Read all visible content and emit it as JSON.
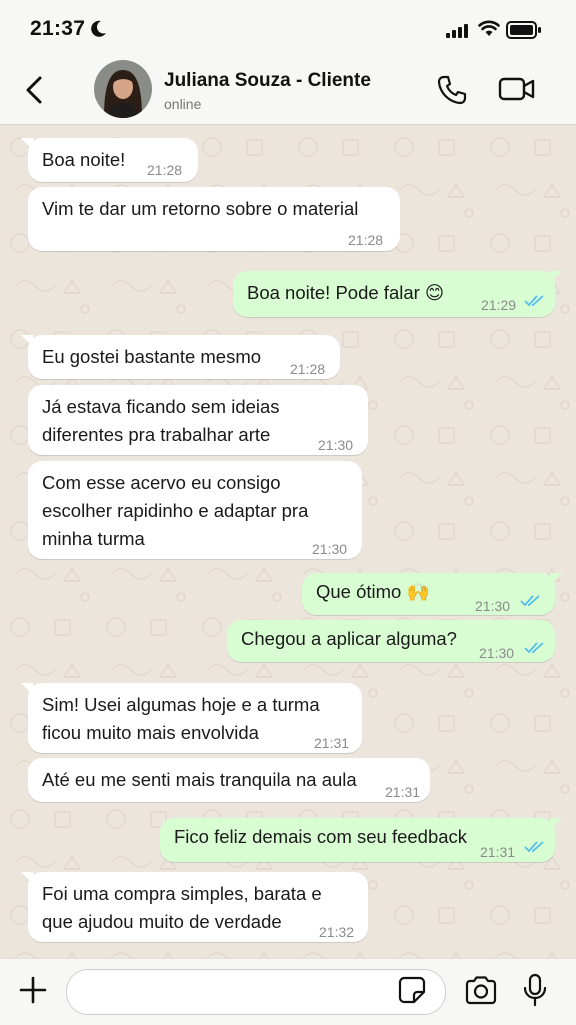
{
  "status_bar": {
    "time": "21:37"
  },
  "contact": {
    "name": "Juliana Souza - Cliente",
    "status": "online"
  },
  "messages": [
    {
      "dir": "in",
      "text": "Boa noite!",
      "time": "21:28"
    },
    {
      "dir": "in",
      "text": "Vim te dar um retorno sobre o material",
      "time": "21:28"
    },
    {
      "dir": "out",
      "text": "Boa noite! Pode falar 😊",
      "time": "21:29",
      "read": true
    },
    {
      "dir": "in",
      "text": "Eu gostei bastante mesmo",
      "time": "21:28"
    },
    {
      "dir": "in",
      "text": "Já estava ficando sem ideias\ndiferentes pra trabalhar arte",
      "time": "21:30"
    },
    {
      "dir": "in",
      "text": "Com esse acervo eu consigo\nescolher rapidinho e adaptar pra\nminha turma",
      "time": "21:30"
    },
    {
      "dir": "out",
      "text": "Que ótimo 🙌",
      "time": "21:30",
      "read": true
    },
    {
      "dir": "out",
      "text": "Chegou a aplicar alguma?",
      "time": "21:30",
      "read": true
    },
    {
      "dir": "in",
      "text": "Sim! Usei algumas hoje e a turma\nficou muito mais envolvida",
      "time": "21:31"
    },
    {
      "dir": "in",
      "text": "Até eu me senti mais tranquila na aula",
      "time": "21:31"
    },
    {
      "dir": "out",
      "text": "Fico feliz demais com seu feedback",
      "time": "21:31",
      "read": true
    },
    {
      "dir": "in",
      "text": "Foi uma compra simples, barata e\nque ajudou muito de verdade",
      "time": "21:32"
    }
  ],
  "input": {
    "placeholder": ""
  },
  "colors": {
    "incoming": "#ffffff",
    "outgoing": "#d9fdd3",
    "read_ticks": "#53bdeb",
    "wallpaper": "#ece5dc"
  }
}
